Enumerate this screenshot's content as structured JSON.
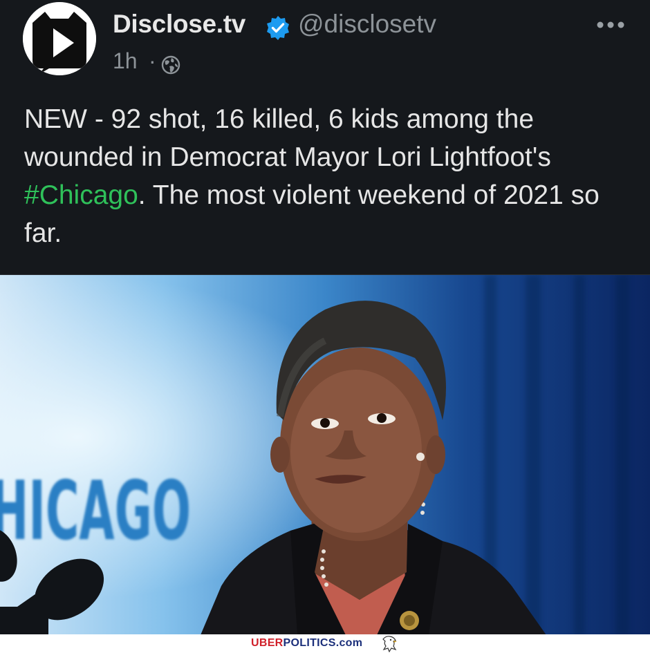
{
  "post": {
    "author_name": "Disclose.tv",
    "handle": "@disclosetv",
    "time": "1h",
    "separator": "·",
    "text_part1": "NEW - 92 shot, 16 killed, 6 kids among the wounded in Democrat Mayor Lori Lightfoot's ",
    "hashtag": "#Chicago",
    "text_part2": ". The most violent weekend of 2021 so far."
  },
  "image": {
    "sign_text": "HICAGO"
  },
  "watermark": {
    "uber": "UBER",
    "politics": "POLITICS.com"
  },
  "colors": {
    "background": "#15181c",
    "hashtag": "#2fc15a",
    "verified": "#1d9bf0",
    "muted": "#8d9398"
  },
  "icons": [
    "avatar-logo-icon",
    "verified-badge-icon",
    "globe-icon",
    "more-options-icon",
    "eagle-icon"
  ]
}
